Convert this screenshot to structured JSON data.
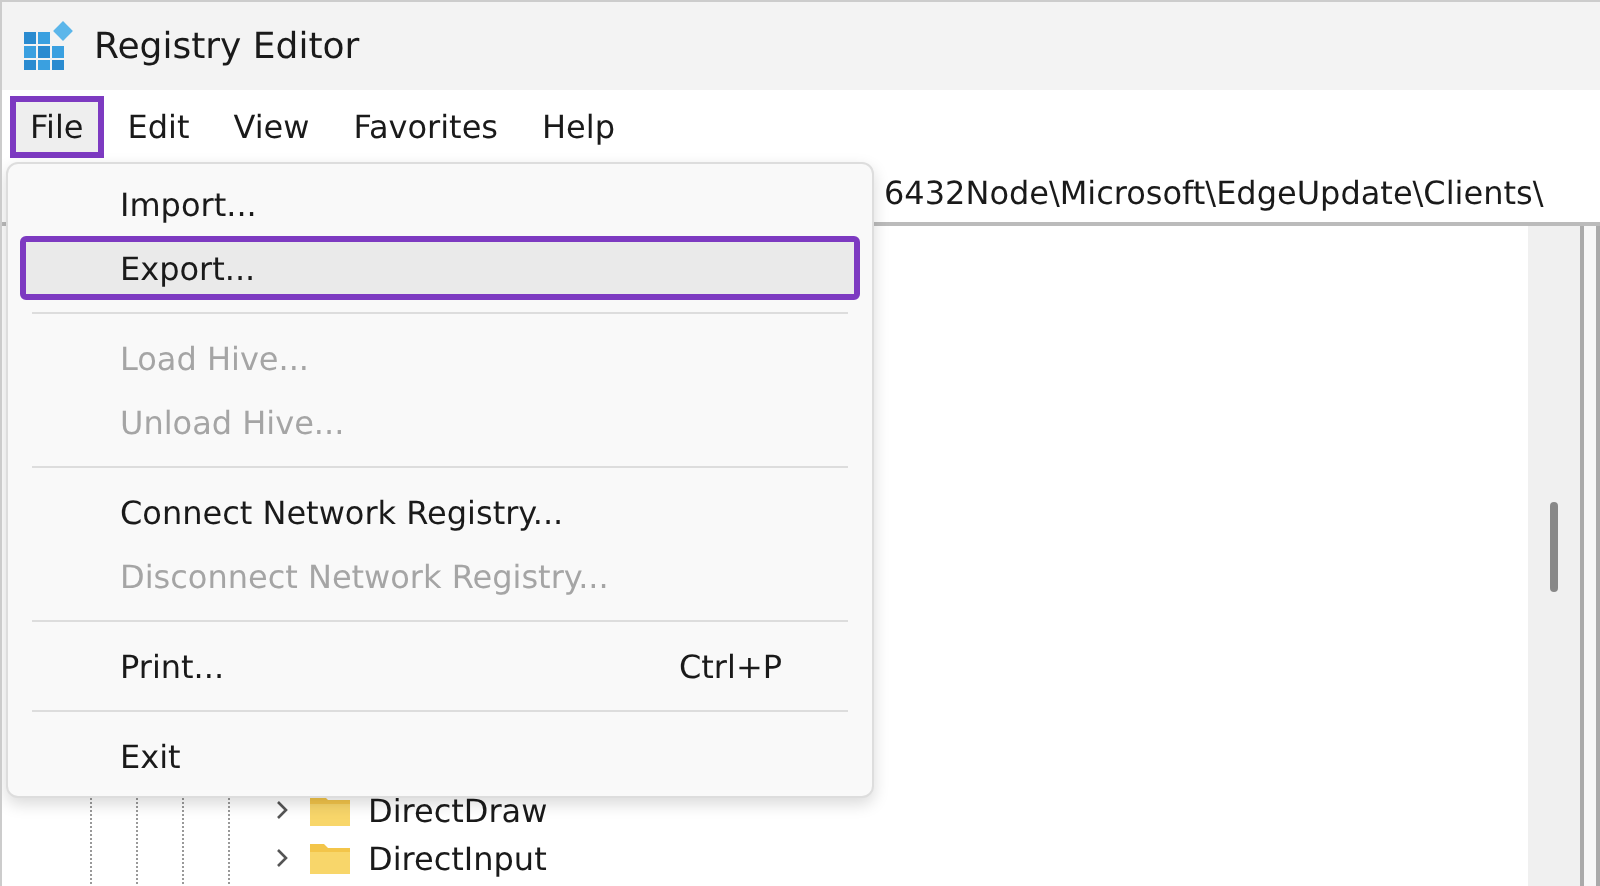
{
  "window": {
    "title": "Registry Editor"
  },
  "menubar": [
    {
      "label": "File",
      "selected": true
    },
    {
      "label": "Edit",
      "selected": false
    },
    {
      "label": "View",
      "selected": false
    },
    {
      "label": "Favorites",
      "selected": false
    },
    {
      "label": "Help",
      "selected": false
    }
  ],
  "address": {
    "value": "6432Node\\Microsoft\\EdgeUpdate\\Clients\\"
  },
  "tree": [
    {
      "label": "DirectDraw",
      "expanded": false
    },
    {
      "label": "DirectInput",
      "expanded": false
    }
  ],
  "file_menu": [
    {
      "kind": "item",
      "label": "Import...",
      "disabled": false,
      "selected": false
    },
    {
      "kind": "item",
      "label": "Export...",
      "disabled": false,
      "selected": true
    },
    {
      "kind": "separator"
    },
    {
      "kind": "item",
      "label": "Load Hive...",
      "disabled": true,
      "selected": false
    },
    {
      "kind": "item",
      "label": "Unload Hive...",
      "disabled": true,
      "selected": false
    },
    {
      "kind": "separator"
    },
    {
      "kind": "item",
      "label": "Connect Network Registry...",
      "disabled": false,
      "selected": false
    },
    {
      "kind": "item",
      "label": "Disconnect Network Registry...",
      "disabled": true,
      "selected": false
    },
    {
      "kind": "separator"
    },
    {
      "kind": "item",
      "label": "Print...",
      "shortcut": "Ctrl+P",
      "disabled": false,
      "selected": false
    },
    {
      "kind": "separator"
    },
    {
      "kind": "item",
      "label": "Exit",
      "disabled": false,
      "selected": false
    }
  ]
}
